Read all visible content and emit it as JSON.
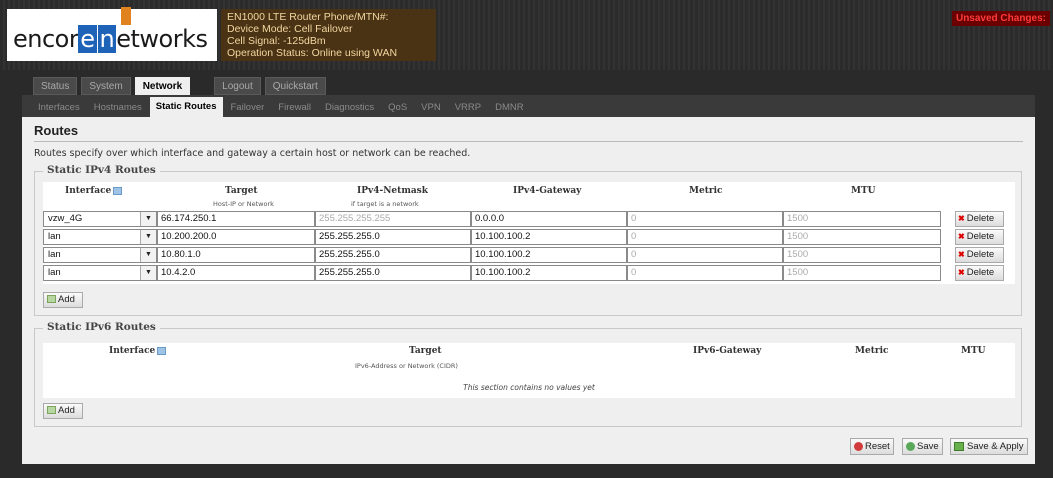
{
  "header": {
    "logo_pre": "encor",
    "logo_e": "e",
    "logo_n": "n",
    "logo_post": "etworks",
    "status": [
      "EN1000 LTE Router Phone/MTN#:",
      "Device Mode: Cell Failover",
      "Cell Signal: -125dBm",
      "Operation Status: Online using WAN"
    ],
    "unsaved": "Unsaved Changes:"
  },
  "top_tabs": [
    "Status",
    "System",
    "Network",
    "Logout",
    "Quickstart"
  ],
  "sub_tabs": [
    "Interfaces",
    "Hostnames",
    "Static Routes",
    "Failover",
    "Firewall",
    "Diagnostics",
    "QoS",
    "VPN",
    "VRRP",
    "DMNR"
  ],
  "page": {
    "title": "Routes",
    "description": "Routes specify over which interface and gateway a certain host or network can be reached."
  },
  "ipv4": {
    "legend": "Static IPv4 Routes",
    "headers": {
      "interface": "Interface",
      "target": "Target",
      "target_sub": "Host-IP or Network",
      "netmask": "IPv4-Netmask",
      "netmask_sub": "if target is a network",
      "gateway": "IPv4-Gateway",
      "metric": "Metric",
      "mtu": "MTU"
    },
    "rows": [
      {
        "interface": "vzw_4G",
        "target": "66.174.250.1",
        "netmask": "255.255.255.255",
        "gateway": "0.0.0.0",
        "metric": "0",
        "mtu": "1500"
      },
      {
        "interface": "lan",
        "target": "10.200.200.0",
        "netmask": "255.255.255.0",
        "gateway": "10.100.100.2",
        "metric": "0",
        "mtu": "1500"
      },
      {
        "interface": "lan",
        "target": "10.80.1.0",
        "netmask": "255.255.255.0",
        "gateway": "10.100.100.2",
        "metric": "0",
        "mtu": "1500"
      },
      {
        "interface": "lan",
        "target": "10.4.2.0",
        "netmask": "255.255.255.0",
        "gateway": "10.100.100.2",
        "metric": "0",
        "mtu": "1500"
      }
    ],
    "delete_label": "Delete",
    "add_label": "Add"
  },
  "ipv6": {
    "legend": "Static IPv6 Routes",
    "headers": {
      "interface": "Interface",
      "target": "Target",
      "target_sub": "IPv6-Address or Network (CIDR)",
      "gateway": "IPv6-Gateway",
      "metric": "Metric",
      "mtu": "MTU"
    },
    "empty": "This section contains no values yet",
    "add_label": "Add"
  },
  "footer": {
    "reset": "Reset",
    "save": "Save",
    "save_apply": "Save & Apply"
  },
  "colors": {
    "unsaved": "#ff3b3b",
    "status_text": "#f2d7a0",
    "logo_blue": "#1e63b8",
    "logo_orange": "#e0821d"
  }
}
